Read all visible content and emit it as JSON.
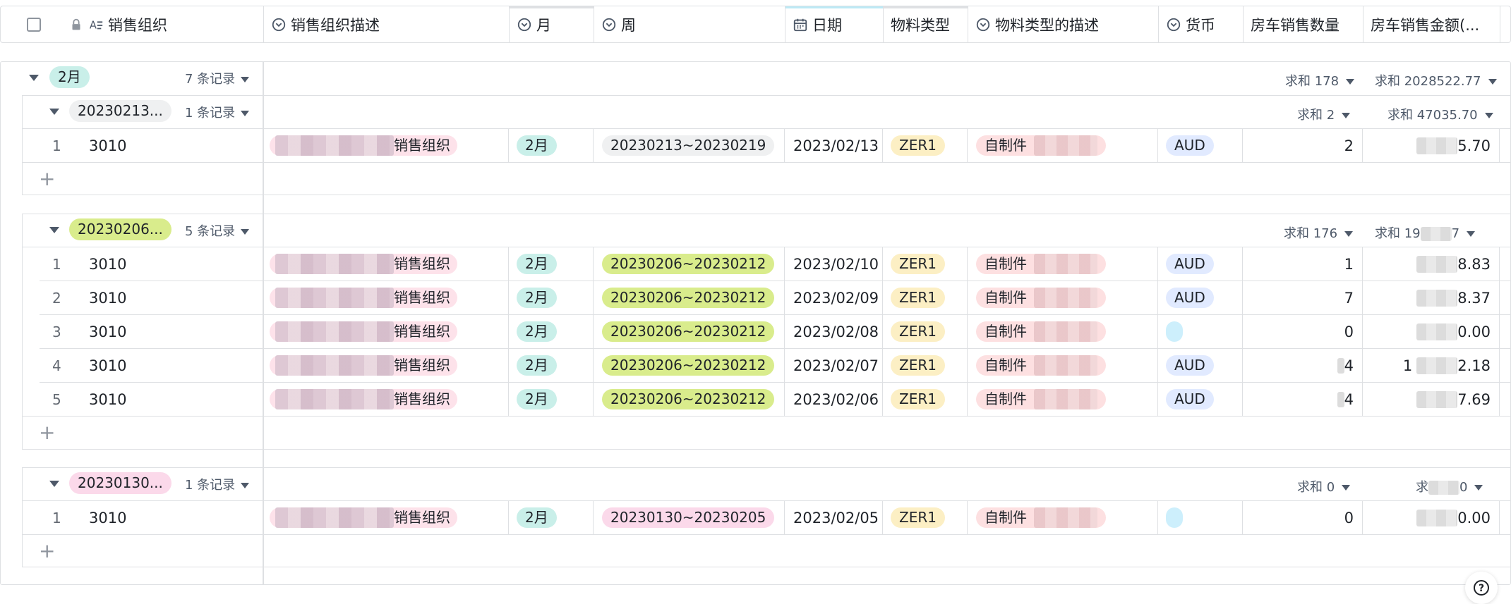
{
  "header": {
    "columns": [
      {
        "label": "销售组织",
        "icon": "text-icon"
      },
      {
        "label": "销售组织描述",
        "icon": "single-select-icon"
      },
      {
        "label": "月",
        "icon": "single-select-icon"
      },
      {
        "label": "周",
        "icon": "single-select-icon"
      },
      {
        "label": "日期",
        "icon": "calendar-icon"
      },
      {
        "label": "物料类型",
        "icon": ""
      },
      {
        "label": "物料类型的描述",
        "icon": "single-select-icon"
      },
      {
        "label": "货币",
        "icon": "single-select-icon"
      },
      {
        "label": "房车销售数量",
        "icon": ""
      },
      {
        "label": "房车销售金额(...",
        "icon": ""
      }
    ]
  },
  "groups": {
    "top": {
      "tag": "2月",
      "count": "7 条记录",
      "sum_qty": "求和 178",
      "sum_amt": "求和 2028522.77"
    },
    "g1": {
      "tag": "20230213...",
      "count": "1 条记录",
      "sum_qty": "求和 2",
      "sum_amt": "求和 47035.70"
    },
    "g2": {
      "tag": "20230206...",
      "count": "5 条记录",
      "sum_qty": "求和 176",
      "sum_amt": "求和 19",
      "sum_amt_tail": "7"
    },
    "g3": {
      "tag": "20230130...",
      "count": "1 条记录",
      "sum_qty": "求和 0",
      "sum_amt": "求",
      "sum_amt_tail": "0"
    }
  },
  "rows": {
    "g1": [
      {
        "idx": "1",
        "org": "3010",
        "desc": "销售组织",
        "month": "2月",
        "week": "20230213~20230219",
        "date": "2023/02/13",
        "mtype": "ZER1",
        "mdesc": "自制件",
        "cur": "AUD",
        "qty": "2",
        "amt": "5.70"
      }
    ],
    "g2": [
      {
        "idx": "1",
        "org": "3010",
        "desc": "销售组织",
        "month": "2月",
        "week": "20230206~20230212",
        "date": "2023/02/10",
        "mtype": "ZER1",
        "mdesc": "自制件",
        "cur": "AUD",
        "qty": "1",
        "amt": "8.83"
      },
      {
        "idx": "2",
        "org": "3010",
        "desc": "销售组织",
        "month": "2月",
        "week": "20230206~20230212",
        "date": "2023/02/09",
        "mtype": "ZER1",
        "mdesc": "自制件",
        "cur": "AUD",
        "qty": "7",
        "amt": "8.37"
      },
      {
        "idx": "3",
        "org": "3010",
        "desc": "销售组织",
        "month": "2月",
        "week": "20230206~20230212",
        "date": "2023/02/08",
        "mtype": "ZER1",
        "mdesc": "自制件",
        "cur": "",
        "qty": "0",
        "amt": "0.00"
      },
      {
        "idx": "4",
        "org": "3010",
        "desc": "销售组织",
        "month": "2月",
        "week": "20230206~20230212",
        "date": "2023/02/07",
        "mtype": "ZER1",
        "mdesc": "自制件",
        "cur": "AUD",
        "qty": "4",
        "amt": "2.18",
        "amt_lead": "1"
      },
      {
        "idx": "5",
        "org": "3010",
        "desc": "销售组织",
        "month": "2月",
        "week": "20230206~20230212",
        "date": "2023/02/06",
        "mtype": "ZER1",
        "mdesc": "自制件",
        "cur": "AUD",
        "qty": "4",
        "amt": "7.69"
      }
    ],
    "g3": [
      {
        "idx": "1",
        "org": "3010",
        "desc": "销售组织",
        "month": "2月",
        "week": "20230130~20230205",
        "date": "2023/02/05",
        "mtype": "ZER1",
        "mdesc": "自制件",
        "cur": "",
        "qty": "0",
        "amt": "0.00"
      }
    ]
  },
  "add_row_symbol": "+",
  "help_symbol": "?",
  "colors": {
    "accent_month": "#c9efe9",
    "border": "#dee0e3"
  }
}
